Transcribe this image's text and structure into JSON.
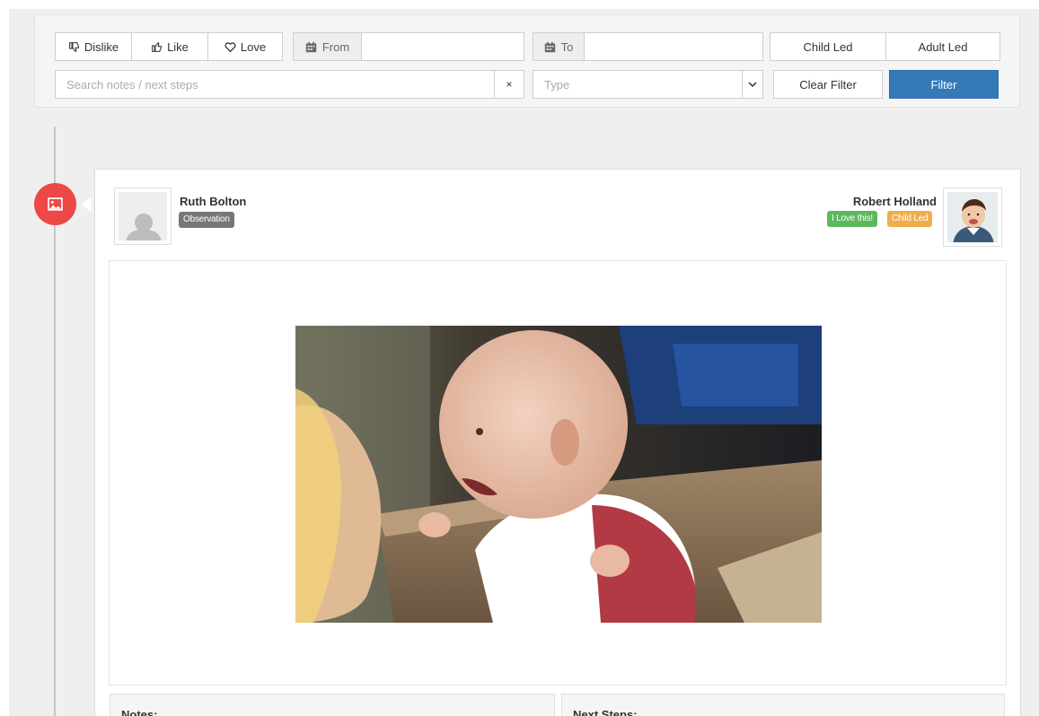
{
  "filters": {
    "dislike_label": "Dislike",
    "like_label": "Like",
    "love_label": "Love",
    "from_label": "From",
    "from_value": "",
    "to_label": "To",
    "to_value": "",
    "child_led_label": "Child Led",
    "adult_led_label": "Adult Led",
    "search_placeholder": "Search notes / next steps",
    "search_clear": "×",
    "type_placeholder": "Type",
    "clear_filter_label": "Clear Filter",
    "filter_label": "Filter"
  },
  "timeline": {
    "entry_icon": "image-icon",
    "author": {
      "name": "Ruth Bolton",
      "role_badge": "Observation"
    },
    "child": {
      "name": "Robert Holland",
      "badges": [
        "I Love this!",
        "Child Led"
      ]
    },
    "sections": {
      "notes_label": "Notes:",
      "next_steps_label": "Next Steps:"
    }
  },
  "colors": {
    "primary": "#337ab7",
    "timeline_dot": "#ec4848",
    "badge_dark": "#777777",
    "badge_success": "#5cb85c",
    "badge_warning": "#f0ad4e"
  }
}
